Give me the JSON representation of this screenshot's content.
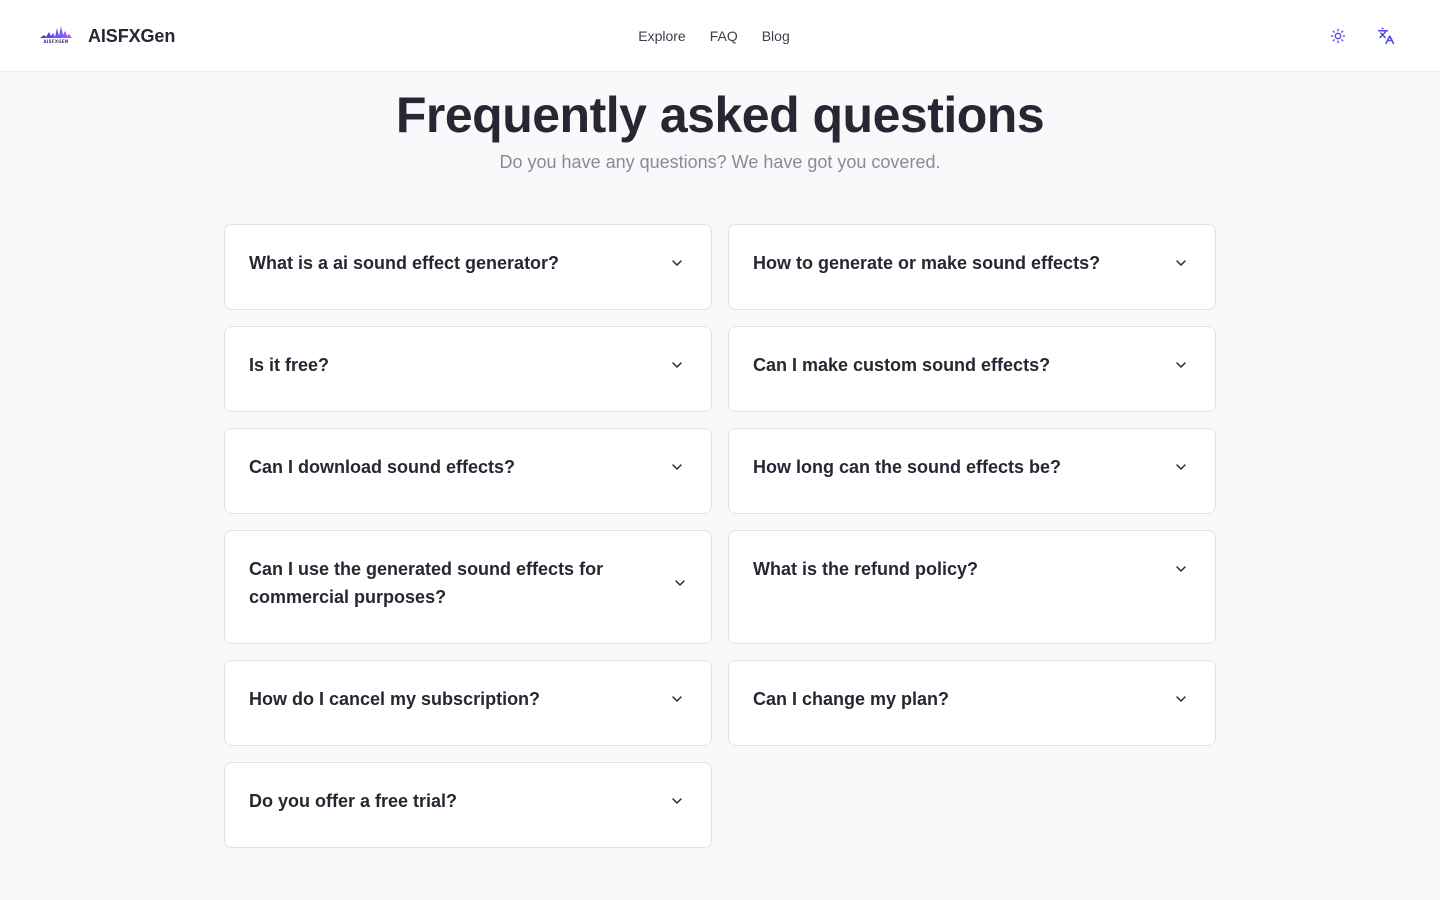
{
  "header": {
    "brand": "AISFXGen",
    "logo_tag": "AISFXGEN",
    "nav": [
      "Explore",
      "FAQ",
      "Blog"
    ],
    "accent_color": "#4f46e5",
    "icons": {
      "theme": "sun-icon",
      "language": "translate-icon"
    }
  },
  "page": {
    "title": "Frequently asked questions",
    "subtitle": "Do you have any questions? We have got you covered."
  },
  "faq": {
    "left": [
      "What is a ai sound effect generator?",
      "Is it free?",
      "Can I download sound effects?",
      "Can I use the generated sound effects for commercial purposes?",
      "How do I cancel my subscription?",
      "Do you offer a free trial?"
    ],
    "right": [
      "How to generate or make sound effects?",
      "Can I make custom sound effects?",
      "How long can the sound effects be?",
      "What is the refund policy?",
      "Can I change my plan?"
    ]
  }
}
